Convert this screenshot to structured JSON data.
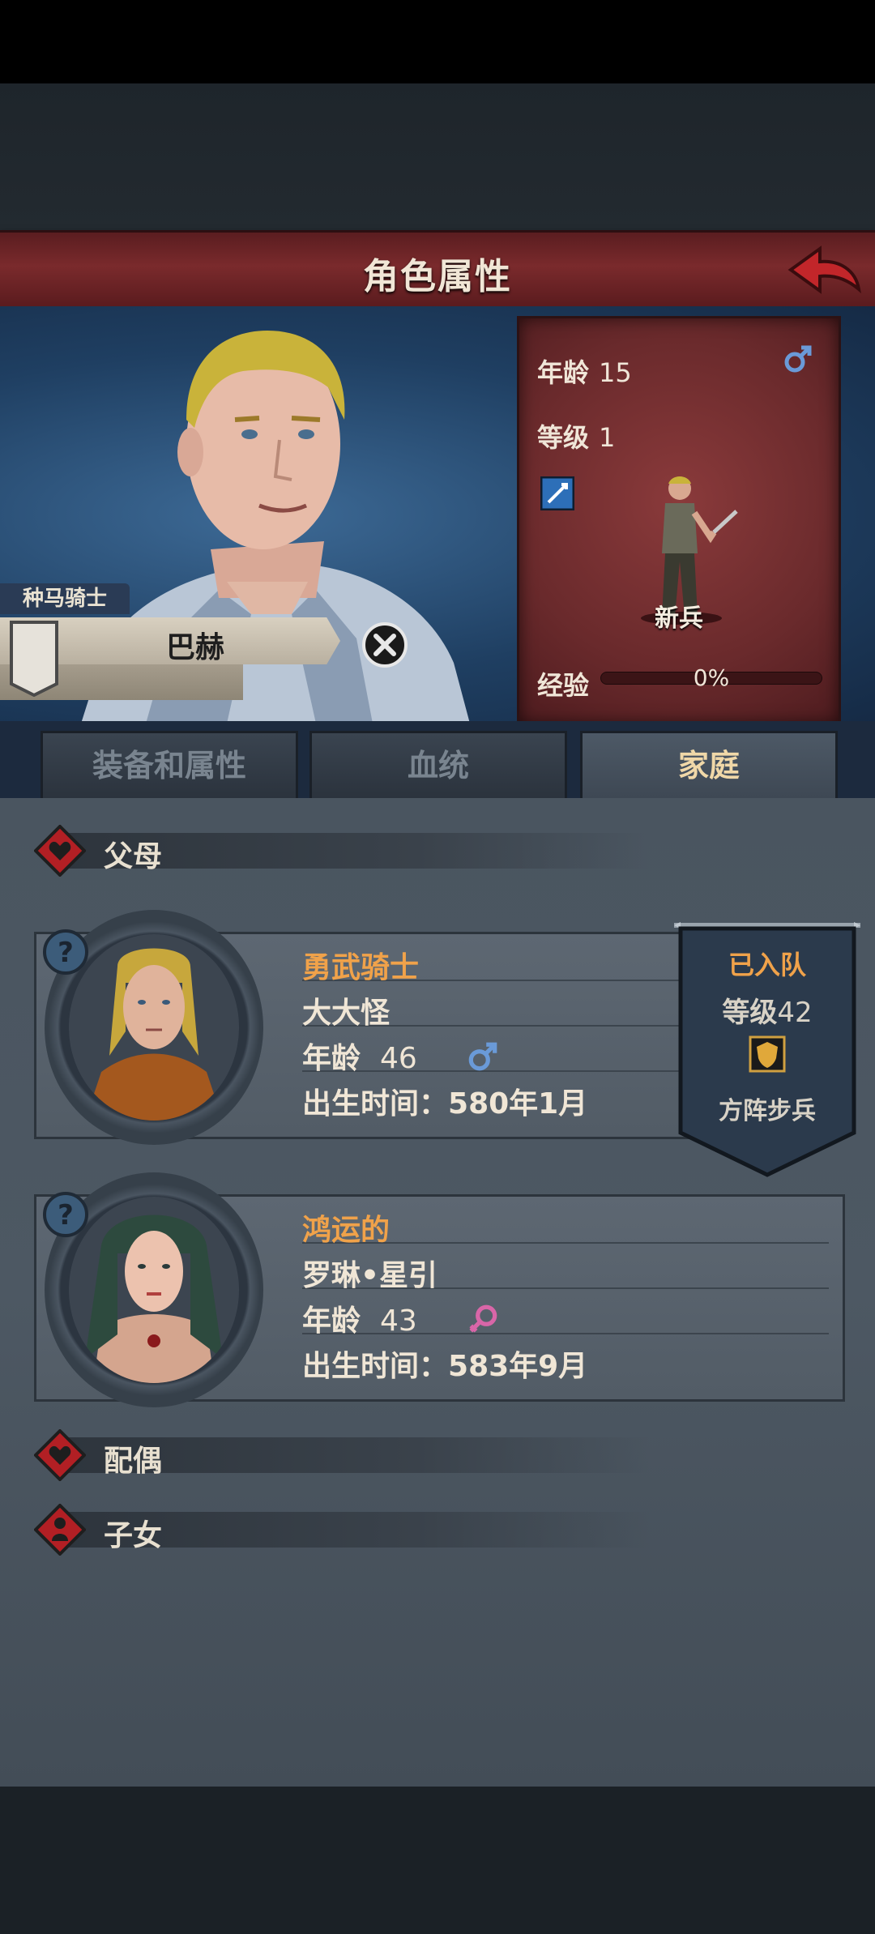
{
  "screen": {
    "title": "角色属性"
  },
  "character": {
    "class": "种马骑士",
    "name": "巴赫",
    "stats": {
      "age_label": "年龄",
      "age": "15",
      "level_label": "等级",
      "level": "1",
      "unit": "新兵",
      "exp_label": "经验",
      "exp": "0%"
    }
  },
  "tabs": [
    {
      "label": "装备和属性"
    },
    {
      "label": "血统"
    },
    {
      "label": "家庭"
    }
  ],
  "family": {
    "parents_label": "父母",
    "spouse_label": "配偶",
    "children_label": "子女",
    "father": {
      "title": "勇武骑士",
      "name": "大大怪",
      "age_label": "年龄",
      "age": "46",
      "birth_label": "出生时间：",
      "birth": "580年1月",
      "team_status": "已入队",
      "team_level_label": "等级",
      "team_level": "42",
      "team_unit": "方阵步兵"
    },
    "mother": {
      "title": "鸿运的",
      "name": "罗琳•星引",
      "age_label": "年龄",
      "age": "43",
      "birth_label": "出生时间：",
      "birth": "583年9月"
    }
  },
  "colors": {
    "accent_red": "#7a2a2c",
    "title_orange": "#f0a24a",
    "male_blue": "#6a9ad8",
    "female_pink": "#d866a8"
  },
  "icons": [
    "back-arrow-icon",
    "male-icon",
    "female-icon",
    "sword-skill-icon",
    "close-icon",
    "heart-diamond-icon",
    "child-diamond-icon",
    "question-icon",
    "shield-icon"
  ]
}
